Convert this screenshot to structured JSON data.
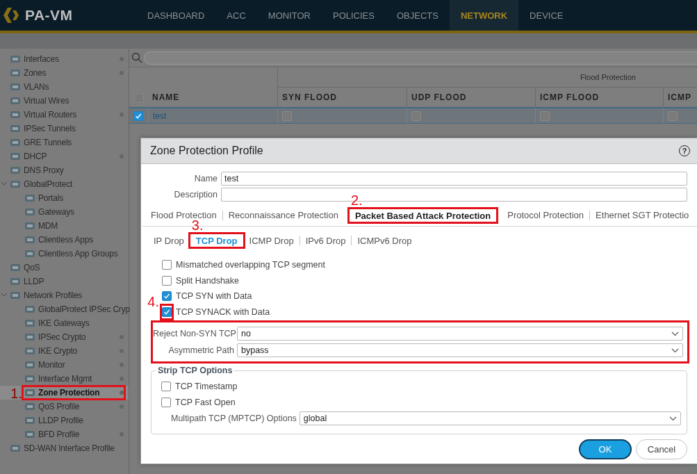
{
  "app": {
    "logo": "PA-VM"
  },
  "nav_tabs": [
    {
      "label": "DASHBOARD",
      "selected": false
    },
    {
      "label": "ACC",
      "selected": false
    },
    {
      "label": "MONITOR",
      "selected": false
    },
    {
      "label": "POLICIES",
      "selected": false
    },
    {
      "label": "OBJECTS",
      "selected": false
    },
    {
      "label": "NETWORK",
      "selected": true
    },
    {
      "label": "DEVICE",
      "selected": false
    }
  ],
  "sidebar": {
    "items": [
      {
        "label": "Interfaces",
        "dot": true,
        "selected": false
      },
      {
        "label": "Zones",
        "dot": true,
        "selected": false
      },
      {
        "label": "VLANs",
        "dot": false,
        "selected": false
      },
      {
        "label": "Virtual Wires",
        "dot": false,
        "selected": false
      },
      {
        "label": "Virtual Routers",
        "dot": true,
        "selected": false
      },
      {
        "label": "IPSec Tunnels",
        "dot": false,
        "selected": false
      },
      {
        "label": "GRE Tunnels",
        "dot": false,
        "selected": false
      },
      {
        "label": "DHCP",
        "dot": true,
        "selected": false
      },
      {
        "label": "DNS Proxy",
        "dot": false,
        "selected": false
      },
      {
        "label": "GlobalProtect",
        "dot": false,
        "selected": false,
        "expanded": true,
        "children": [
          {
            "label": "Portals",
            "dot": false,
            "selected": false
          },
          {
            "label": "Gateways",
            "dot": false,
            "selected": false
          },
          {
            "label": "MDM",
            "dot": false,
            "selected": false
          },
          {
            "label": "Clientless Apps",
            "dot": false,
            "selected": false
          },
          {
            "label": "Clientless App Groups",
            "dot": false,
            "selected": false
          }
        ]
      },
      {
        "label": "QoS",
        "dot": false,
        "selected": false
      },
      {
        "label": "LLDP",
        "dot": false,
        "selected": false
      },
      {
        "label": "Network Profiles",
        "dot": false,
        "selected": false,
        "expanded": true,
        "children": [
          {
            "label": "GlobalProtect IPSec Cryp",
            "dot": false,
            "selected": false
          },
          {
            "label": "IKE Gateways",
            "dot": false,
            "selected": false
          },
          {
            "label": "IPSec Crypto",
            "dot": true,
            "selected": false
          },
          {
            "label": "IKE Crypto",
            "dot": true,
            "selected": false
          },
          {
            "label": "Monitor",
            "dot": true,
            "selected": false
          },
          {
            "label": "Interface Mgmt",
            "dot": true,
            "selected": false
          },
          {
            "label": "Zone Protection",
            "dot": true,
            "selected": true,
            "annotation": "1."
          },
          {
            "label": "QoS Profile",
            "dot": true,
            "selected": false
          },
          {
            "label": "LLDP Profile",
            "dot": false,
            "selected": false
          },
          {
            "label": "BFD Profile",
            "dot": true,
            "selected": false
          }
        ]
      },
      {
        "label": "SD-WAN Interface Profile",
        "dot": false,
        "selected": false
      }
    ]
  },
  "table": {
    "group_header": "Flood Protection",
    "header_checked": false,
    "columns": [
      "NAME",
      "SYN FLOOD",
      "UDP FLOOD",
      "ICMP FLOOD",
      "ICMP"
    ],
    "rows": [
      {
        "name": "test",
        "selected": true,
        "checked": true,
        "flags": [
          {
            "checked": false
          },
          {
            "checked": false
          },
          {
            "checked": false
          },
          {
            "checked": false
          }
        ]
      }
    ]
  },
  "dialog": {
    "title": "Zone Protection Profile",
    "help": "?",
    "fields": [
      {
        "label": "Name",
        "value": "test"
      },
      {
        "label": "Description"
      }
    ],
    "tabs": [
      {
        "label": "Flood Protection",
        "selected": false
      },
      {
        "label": "Reconnaissance Protection",
        "selected": false
      },
      {
        "label": "Packet Based Attack Protection",
        "selected": true,
        "annotation": "2."
      },
      {
        "label": "Protocol Protection",
        "selected": false
      },
      {
        "label": "Ethernet SGT Protectio",
        "selected": false
      }
    ],
    "subtabs": [
      {
        "label": "IP Drop",
        "selected": false
      },
      {
        "label": "TCP Drop",
        "selected": true,
        "annotation": "3."
      },
      {
        "label": "ICMP Drop",
        "selected": false
      },
      {
        "label": "IPv6 Drop",
        "selected": false
      },
      {
        "label": "ICMPv6 Drop",
        "selected": false
      }
    ],
    "checks": [
      {
        "label": "Mismatched overlapping TCP segment",
        "checked": false
      },
      {
        "label": "Split Handshake",
        "checked": false
      },
      {
        "label": "TCP SYN with Data",
        "checked": true
      },
      {
        "label": "TCP SYNACK with Data",
        "checked": true,
        "annotation": "4."
      }
    ],
    "selects": [
      {
        "label": "Reject Non-SYN TCP",
        "value": "no"
      },
      {
        "label": "Asymmetric Path",
        "value": "bypass"
      }
    ],
    "strip_options": {
      "legend": "Strip TCP Options",
      "checks": [
        {
          "label": "TCP Timestamp",
          "checked": false
        },
        {
          "label": "TCP Fast Open",
          "checked": false
        }
      ],
      "select": {
        "label": "Multipath TCP (MPTCP) Options",
        "value": "global"
      }
    },
    "buttons": [
      {
        "label": "OK",
        "kind": "primary"
      },
      {
        "label": "Cancel",
        "kind": "secondary"
      }
    ]
  }
}
